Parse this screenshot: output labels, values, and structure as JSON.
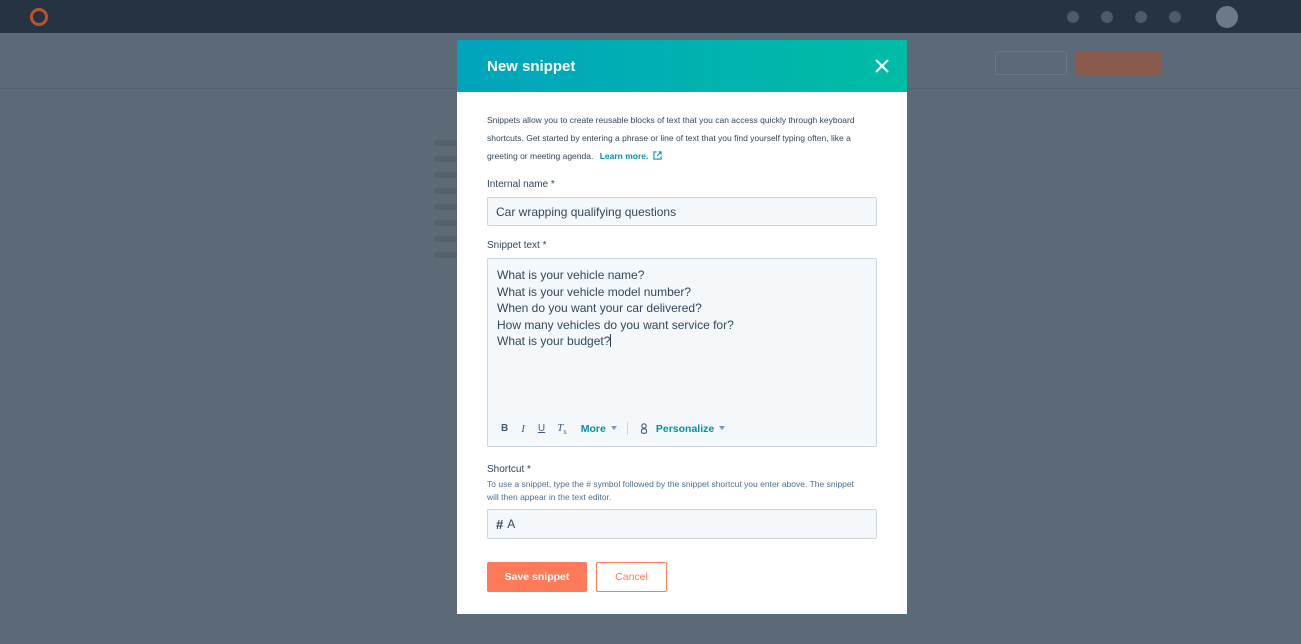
{
  "modal": {
    "title": "New snippet",
    "intro": "Snippets allow you to create reusable blocks of text that you can access quickly through keyboard shortcuts. Get started by entering a phrase or line of text that you find yourself typing often, like a greeting or meeting agenda.",
    "learn_more": "Learn more.",
    "internal_name_label": "Internal name *",
    "internal_name_value": "Car wrapping qualifying questions",
    "snippet_text_label": "Snippet text *",
    "snippet_lines": [
      "What is your vehicle name?",
      "What is your vehicle model number?",
      "When do you want your car delivered?",
      "How many vehicles do you want service for?",
      "What is your budget?"
    ],
    "toolbar": {
      "bold": "B",
      "italic": "I",
      "underline": "U",
      "clear_format": "T",
      "clear_format_sub": "x",
      "more": "More",
      "personalize": "Personalize"
    },
    "shortcut_label": "Shortcut *",
    "shortcut_hint": "To use a snippet, type the # symbol followed by the snippet shortcut you enter above. The snippet will then appear in the text editor.",
    "shortcut_prefix": "#",
    "shortcut_value": "A",
    "save_label": "Save snippet",
    "cancel_label": "Cancel"
  },
  "colors": {
    "header_start": "#00a4bd",
    "header_end": "#00bda5",
    "primary_button": "#ff7a59",
    "link": "#0091ae",
    "overlay": "#5c6977"
  },
  "icons": [
    "close-icon",
    "external-link-icon",
    "personalize-icon",
    "dropdown-caret-icon"
  ]
}
